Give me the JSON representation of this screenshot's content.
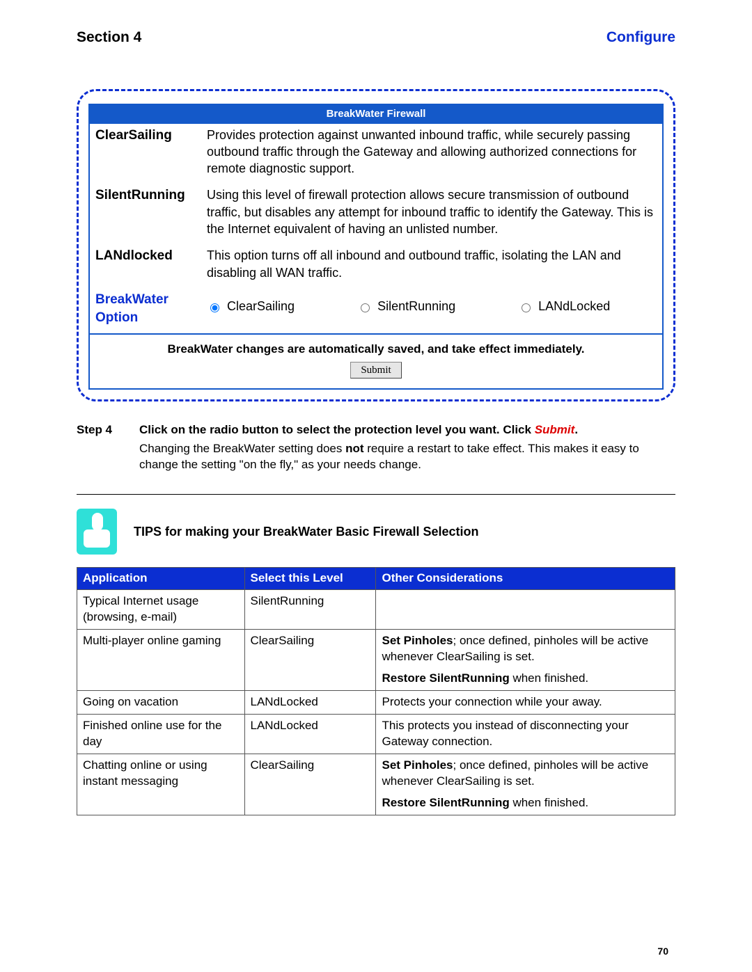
{
  "header": {
    "left": "Section 4",
    "right": "Configure"
  },
  "firewall": {
    "title": "BreakWater Firewall",
    "rows": [
      {
        "label": "ClearSailing",
        "desc": "Provides protection against unwanted inbound traffic, while securely passing outbound traffic through the Gateway and allowing authorized connections for remote diagnostic support."
      },
      {
        "label": "SilentRunning",
        "desc": "Using this level of firewall protection allows secure transmission of outbound traffic, but disables any attempt for inbound traffic to identify the Gateway. This is the Internet equivalent of having an unlisted number."
      },
      {
        "label": "LANdlocked",
        "desc": "This option turns off all inbound and outbound traffic, isolating the LAN and disabling all WAN traffic."
      }
    ],
    "option_label": "BreakWater Option",
    "radios": [
      "ClearSailing",
      "SilentRunning",
      "LANdLocked"
    ],
    "selected": "ClearSailing",
    "note": "BreakWater changes are automatically saved, and take effect immediately.",
    "submit": "Submit"
  },
  "step": {
    "label": "Step 4",
    "line1a": "Click on the radio button to select the protection level you want. Click ",
    "line1b": "Submit",
    "line1c": ".",
    "detail_pre": "Changing the BreakWater setting does ",
    "detail_bold": "not",
    "detail_post": " require a restart to take effect. This makes it easy to change the setting \"on the fly,\" as your needs change."
  },
  "tips": {
    "title": "TIPS for making your BreakWater Basic Firewall Selection",
    "headers": [
      "Application",
      "Select this Level",
      "Other Considerations"
    ],
    "rows": [
      {
        "app": "Typical Internet usage (browsing, e-mail)",
        "level": "SilentRunning",
        "other": []
      },
      {
        "app": "Multi-player online gaming",
        "level": "ClearSailing",
        "other": [
          {
            "parts": [
              {
                "t": "Set Pinholes",
                "b": true
              },
              {
                "t": "; once defined, pinholes will be active whenever ClearSailing is set."
              }
            ]
          },
          {
            "parts": [
              {
                "t": "Restore SilentRunning",
                "b": true
              },
              {
                "t": " when finished."
              }
            ]
          }
        ]
      },
      {
        "app": "Going on vacation",
        "level": "LANdLocked",
        "other": [
          {
            "parts": [
              {
                "t": "Protects your connection while your away."
              }
            ]
          }
        ]
      },
      {
        "app": "Finished online use for the day",
        "level": "LANdLocked",
        "other": [
          {
            "parts": [
              {
                "t": "This protects you instead of disconnecting your Gateway connection."
              }
            ]
          }
        ]
      },
      {
        "app": "Chatting online or using instant messaging",
        "level": "ClearSailing",
        "other": [
          {
            "parts": [
              {
                "t": "Set Pinholes",
                "b": true
              },
              {
                "t": "; once defined, pinholes will be active whenever ClearSailing is set."
              }
            ]
          },
          {
            "parts": [
              {
                "t": "Restore SilentRunning",
                "b": true
              },
              {
                "t": " when finished."
              }
            ]
          }
        ]
      }
    ]
  },
  "page_number": "70"
}
